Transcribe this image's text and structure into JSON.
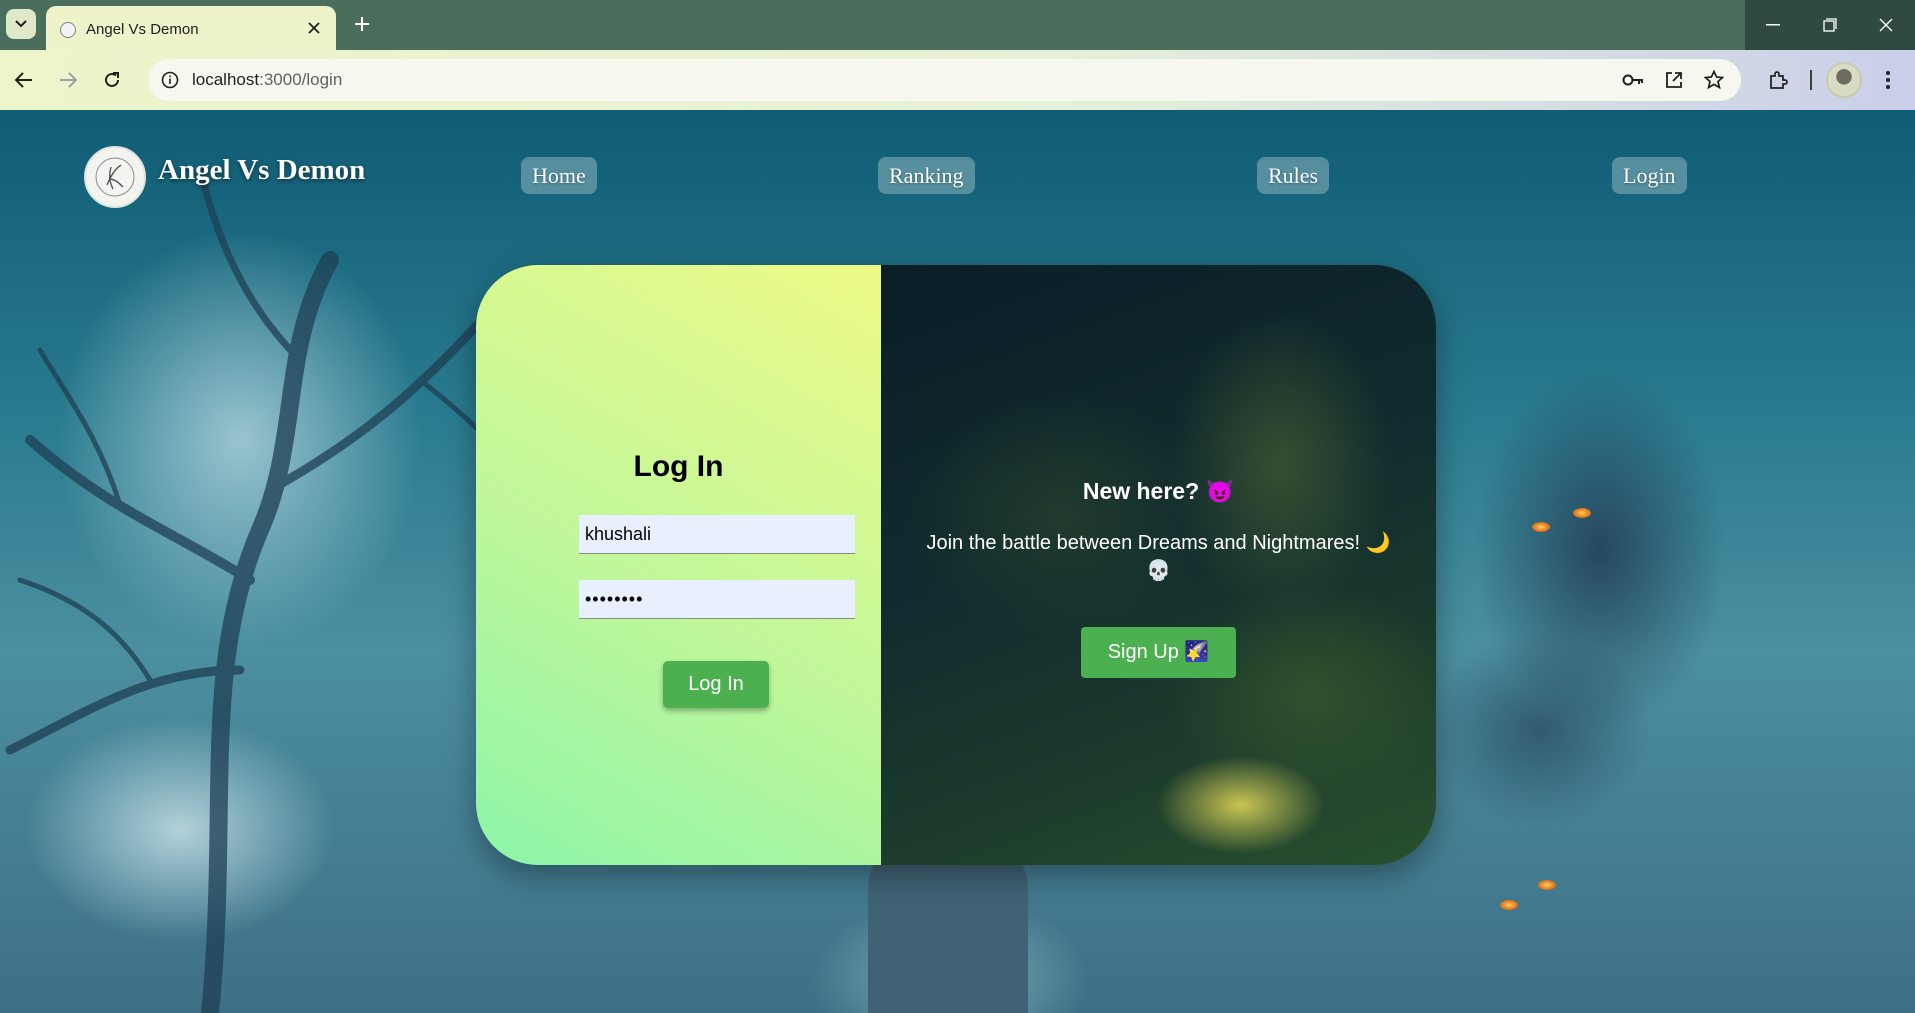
{
  "browser": {
    "tab_title": "Angel Vs Demon",
    "url_host": "localhost",
    "url_path": ":3000/login",
    "icons": [
      "tab-search-icon",
      "favicon-icon",
      "close-icon",
      "new-tab-icon",
      "back-icon",
      "forward-icon",
      "reload-icon",
      "site-info-icon",
      "password-key-icon",
      "open-in-app-icon",
      "bookmark-star-icon",
      "extensions-icon",
      "profile-avatar",
      "menu-kebab-icon",
      "minimize-icon",
      "restore-icon",
      "window-close-icon"
    ]
  },
  "nav": {
    "brand": "Angel Vs Demon",
    "links": [
      "Home",
      "Ranking",
      "Rules",
      "Login"
    ]
  },
  "login": {
    "title": "Log In",
    "username_value": "khushali",
    "password_value": "••••••••",
    "button_label": "Log In"
  },
  "signup": {
    "heading": "New here? 😈",
    "tagline": "Join the battle between Dreams and Nightmares! 🌙 💀",
    "button_label": "Sign Up 🌠"
  },
  "colors": {
    "button_green": "#4caf50",
    "tabstrip": "#4a6d5c",
    "input_bg": "#e8f0fe"
  }
}
